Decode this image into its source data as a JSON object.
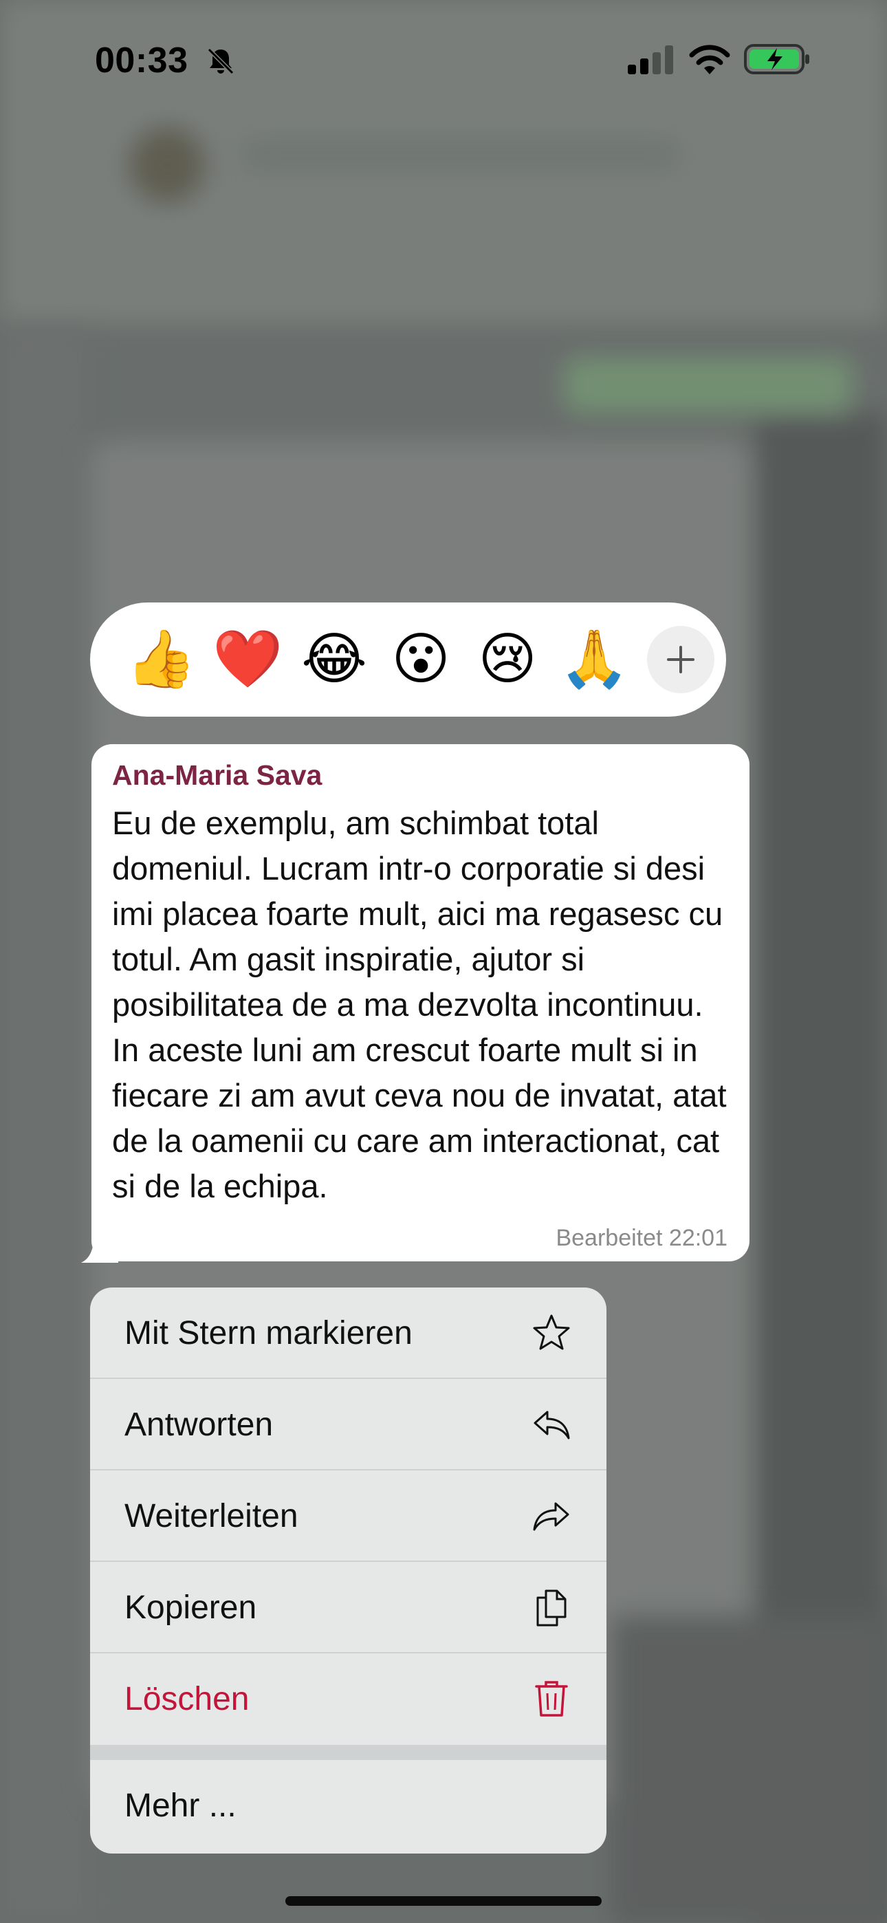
{
  "status_bar": {
    "time": "00:33",
    "icons": [
      "bell-slash-icon",
      "signal-icon",
      "wifi-icon",
      "battery-charging-icon"
    ],
    "battery_color": "#35c759"
  },
  "reactions": {
    "emojis": [
      {
        "name": "thumbs-up",
        "char": "👍"
      },
      {
        "name": "heart",
        "char": "❤️"
      },
      {
        "name": "tears-of-joy",
        "char": "😂"
      },
      {
        "name": "surprised",
        "char": "😮"
      },
      {
        "name": "crying",
        "char": "😢"
      },
      {
        "name": "folded-hands",
        "char": "🙏"
      }
    ],
    "more_icon": "plus-icon"
  },
  "message": {
    "sender": "Ana-Maria Sava",
    "sender_color": "#7b2444",
    "text": "Eu de exemplu, am schimbat total domeniul. Lucram intr-o corporatie si desi imi placea foarte mult, aici ma regasesc cu totul. Am gasit inspiratie, ajutor si posibilitatea de a ma dezvolta incontinuu. In aceste luni am crescut foarte mult si in fiecare zi am avut ceva nou de invatat, atat de la oamenii cu care am interactionat, cat si de la echipa.",
    "meta": "Bearbeitet 22:01"
  },
  "menu": {
    "items": [
      {
        "label": "Mit Stern markieren",
        "icon": "star-icon"
      },
      {
        "label": "Antworten",
        "icon": "reply-icon"
      },
      {
        "label": "Weiterleiten",
        "icon": "forward-icon"
      },
      {
        "label": "Kopieren",
        "icon": "copy-icon"
      },
      {
        "label": "Löschen",
        "icon": "trash-icon",
        "color": "#c3143a"
      }
    ],
    "more_label": "Mehr ..."
  }
}
